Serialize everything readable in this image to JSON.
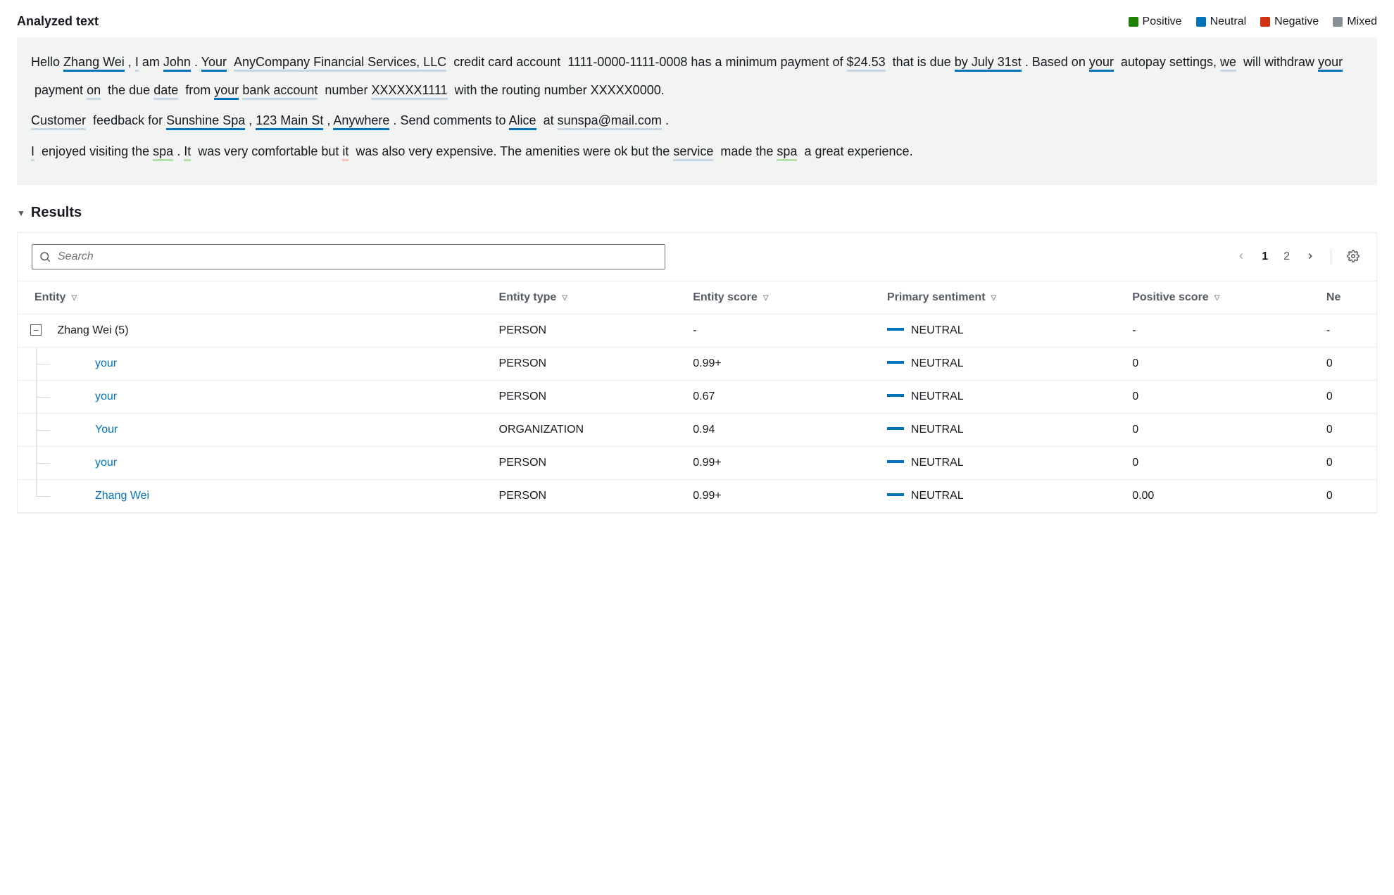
{
  "header": {
    "title": "Analyzed text",
    "legend": [
      {
        "label": "Positive",
        "cls": "sw-positive"
      },
      {
        "label": "Neutral",
        "cls": "sw-neutral"
      },
      {
        "label": "Negative",
        "cls": "sw-negative"
      },
      {
        "label": "Mixed",
        "cls": "sw-mixed"
      }
    ]
  },
  "analyzed_text": {
    "p1": {
      "t0": "Hello",
      "zhang_wei": "Zhang Wei",
      "t1": ",",
      "i": "I",
      "t2": "am",
      "john": "John",
      "t3": ".",
      "your_cap": "Your",
      "company": "AnyCompany Financial Services, LLC",
      "t4": "credit card account",
      "cc": "1111-0000-1111-0008 has a minimum payment",
      "t5": "of",
      "amount": "$24.53",
      "t6": "that is due",
      "due": "by July 31st",
      "t7": ". Based on",
      "your1": "your",
      "t8": "autopay settings,",
      "we": "we",
      "t9": "will withdraw",
      "your2": "your",
      "t10": "payment",
      "on": "on",
      "t11": "the due",
      "date": "date",
      "t12": "from",
      "your3": "your",
      "bank_account": "bank account",
      "t13": "number",
      "masked": "XXXXXX1111",
      "t14": "with the routing number XXXXX0000."
    },
    "p2": {
      "customer": "Customer",
      "t0": "feedback for",
      "sunshine": "Sunshine Spa",
      "t1": ",",
      "addr": "123 Main St",
      "t2": ",",
      "anywhere": "Anywhere",
      "t3": ". Send comments to",
      "alice": "Alice",
      "t4": "at",
      "email": "sunspa@mail.com",
      "t5": "."
    },
    "p3": {
      "i": "I",
      "t0": "enjoyed visiting the",
      "spa1": "spa",
      "t1": ".",
      "it1": "It",
      "t2": "was very comfortable but",
      "it2": "it",
      "t3": "was also very expensive. The amenities were ok but the",
      "service": "service",
      "t4": "made the",
      "spa2": "spa",
      "t5": "a great experience."
    }
  },
  "results": {
    "title": "Results",
    "search_placeholder": "Search",
    "pages": {
      "p1": "1",
      "p2": "2"
    },
    "columns": {
      "entity": "Entity",
      "type": "Entity type",
      "score": "Entity score",
      "sentiment": "Primary sentiment",
      "positive": "Positive score",
      "negative": "Ne"
    },
    "group": {
      "label": "Zhang Wei (5)",
      "type": "PERSON",
      "score": "-",
      "sentiment": "NEUTRAL",
      "positive": "-",
      "negative": "-"
    },
    "rows": [
      {
        "entity": "your",
        "type": "PERSON",
        "score": "0.99+",
        "sentiment": "NEUTRAL",
        "positive": "0",
        "negative": "0"
      },
      {
        "entity": "your",
        "type": "PERSON",
        "score": "0.67",
        "sentiment": "NEUTRAL",
        "positive": "0",
        "negative": "0"
      },
      {
        "entity": "Your",
        "type": "ORGANIZATION",
        "score": "0.94",
        "sentiment": "NEUTRAL",
        "positive": "0",
        "negative": "0"
      },
      {
        "entity": "your",
        "type": "PERSON",
        "score": "0.99+",
        "sentiment": "NEUTRAL",
        "positive": "0",
        "negative": "0"
      },
      {
        "entity": "Zhang Wei",
        "type": "PERSON",
        "score": "0.99+",
        "sentiment": "NEUTRAL",
        "positive": "0.00",
        "negative": "0"
      }
    ]
  }
}
